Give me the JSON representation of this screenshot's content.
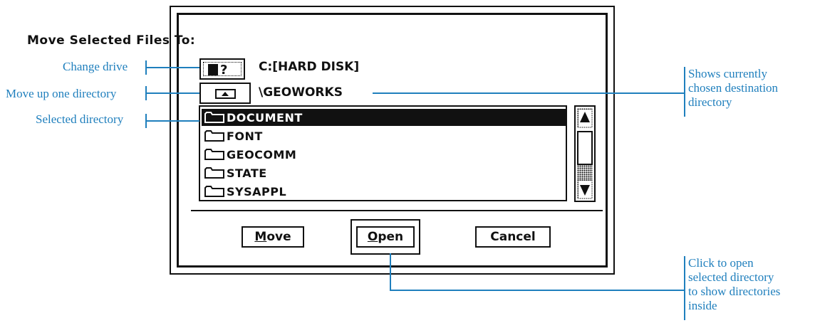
{
  "dialog": {
    "title": "Move Selected Files To:",
    "drive_button_glyph": "?",
    "drive_label": "C:[HARD DISK]",
    "path_label": "\\GEOWORKS",
    "directories": [
      "DOCUMENT",
      "FONT",
      "GEOCOMM",
      "STATE",
      "SYSAPPL"
    ],
    "selected_index": 0,
    "buttons": {
      "move_rest": "ove",
      "move_mnemonic": "M",
      "open_rest": "pen",
      "open_mnemonic": "O",
      "cancel": "Cancel"
    }
  },
  "annotations": {
    "change_drive": "Change drive",
    "move_up": "Move up one directory",
    "selected_directory": "Selected directory",
    "shows_destination": [
      "Shows currently",
      "chosen destination",
      "directory"
    ],
    "click_to_open": [
      "Click to open",
      "selected directory",
      "to show directories",
      "inside"
    ]
  },
  "colors": {
    "annotation": "#1f7fbd",
    "ink": "#111111"
  }
}
